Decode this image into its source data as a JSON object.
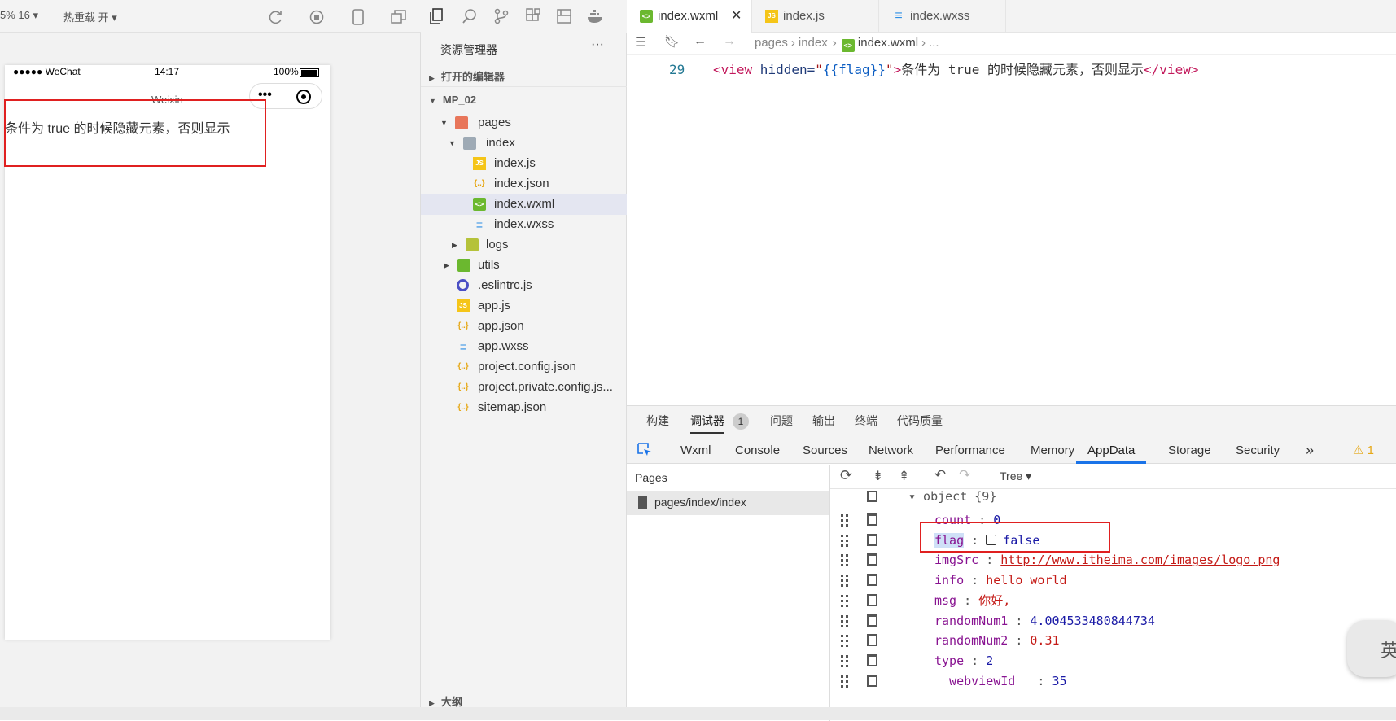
{
  "sim": {
    "zoom": "5% 16 ▾",
    "hotreload": "热重载 开 ▾",
    "carrier": "●●●●● WeChat",
    "time": "14:17",
    "battery": "100%",
    "nav_title": "Weixin",
    "content": "条件为 true 的时候隐藏元素，否则显示"
  },
  "tree": {
    "header": "资源管理器",
    "more": "···",
    "open_editors": "打开的编辑器",
    "project": "MP_02",
    "outline": "大纲",
    "items": [
      {
        "label": "pages",
        "icon": "folder-icon"
      },
      {
        "label": "index",
        "icon": "folder-icon"
      },
      {
        "label": "index.js",
        "icon": "js-file-icon"
      },
      {
        "label": "index.json",
        "icon": "json-file-icon"
      },
      {
        "label": "index.wxml",
        "icon": "wxml-file-icon"
      },
      {
        "label": "index.wxss",
        "icon": "wxss-file-icon"
      },
      {
        "label": "logs",
        "icon": "folder-icon"
      },
      {
        "label": "utils",
        "icon": "folder-icon"
      },
      {
        "label": ".eslintrc.js",
        "icon": "eslint-file-icon"
      },
      {
        "label": "app.js",
        "icon": "js-file-icon"
      },
      {
        "label": "app.json",
        "icon": "json-file-icon"
      },
      {
        "label": "app.wxss",
        "icon": "wxss-file-icon"
      },
      {
        "label": "project.config.json",
        "icon": "json-file-icon"
      },
      {
        "label": "project.private.config.js...",
        "icon": "json-file-icon"
      },
      {
        "label": "sitemap.json",
        "icon": "json-file-icon"
      }
    ]
  },
  "editor": {
    "tabs": [
      {
        "label": "index.wxml"
      },
      {
        "label": "index.js"
      },
      {
        "label": "index.wxss"
      }
    ],
    "breadcrumb": [
      "pages",
      "index",
      "index.wxml",
      "..."
    ],
    "line_no": "29",
    "code": {
      "open": "<view",
      "attr": " hidden=",
      "q1": "\"",
      "expr": "{{flag}}",
      "q2": "\"",
      "gt": ">",
      "text": "条件为 true 的时候隐藏元素，否则显示",
      "close": "</view>"
    }
  },
  "debug": {
    "tabs": [
      "构建",
      "调试器",
      "问题",
      "输出",
      "终端",
      "代码质量"
    ],
    "badge": "1",
    "panels": [
      "Wxml",
      "Console",
      "Sources",
      "Network",
      "Performance",
      "Memory",
      "AppData",
      "Storage",
      "Security"
    ],
    "more": "»",
    "warn": "⚠ 1",
    "view_mode": "Tree ▾",
    "pages_label": "Pages",
    "page_path": "pages/index/index",
    "root": "▾ object {9}",
    "rows": [
      {
        "key": "count",
        "val": "0",
        "type": "num"
      },
      {
        "key": "flag",
        "val": "false",
        "type": "bool"
      },
      {
        "key": "imgSrc",
        "val": "http://www.itheima.com/images/logo.png",
        "type": "link"
      },
      {
        "key": "info",
        "val": "hello world",
        "type": "str"
      },
      {
        "key": "msg",
        "val": "你好,",
        "type": "str"
      },
      {
        "key": "randomNum1",
        "val": "4.004533480844734",
        "type": "num"
      },
      {
        "key": "randomNum2",
        "val": "0.31",
        "type": "numred"
      },
      {
        "key": "type",
        "val": "2",
        "type": "num"
      },
      {
        "key": "__webviewId__",
        "val": "35",
        "type": "num"
      }
    ]
  },
  "ime": "英",
  "colors": {
    "accent": "#1a73e8",
    "highlight_box": "#e02020",
    "tag": "#c2185b"
  }
}
